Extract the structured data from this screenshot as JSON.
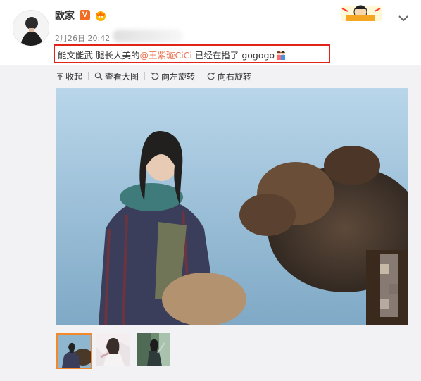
{
  "post": {
    "username": "欧家",
    "verified_badge": "V",
    "timestamp": "2月26日 20:42",
    "content": {
      "prefix": "能文能武 腿长人美的",
      "mention": "@王紫璇CiCi",
      "suffix": " 已经在播了 gogogo"
    },
    "icons": {
      "avatar": "avatar",
      "crown": "crown-badge-icon",
      "header_cartoon": "cartoon-sticker",
      "expand": "chevron-down-icon",
      "emoji": "kids-emoji"
    }
  },
  "toolbar": {
    "collapse_label": "收起",
    "view_large_label": "查看大图",
    "rotate_left_label": "向左旋转",
    "rotate_right_label": "向右旋转"
  },
  "gallery": {
    "thumbnail_count": 3,
    "active_index": 0
  },
  "colors": {
    "accent": "#eb7350",
    "highlight_border": "#e2231a",
    "active_thumb_border": "#f28a2d",
    "panel_bg": "#f2f2f5"
  }
}
